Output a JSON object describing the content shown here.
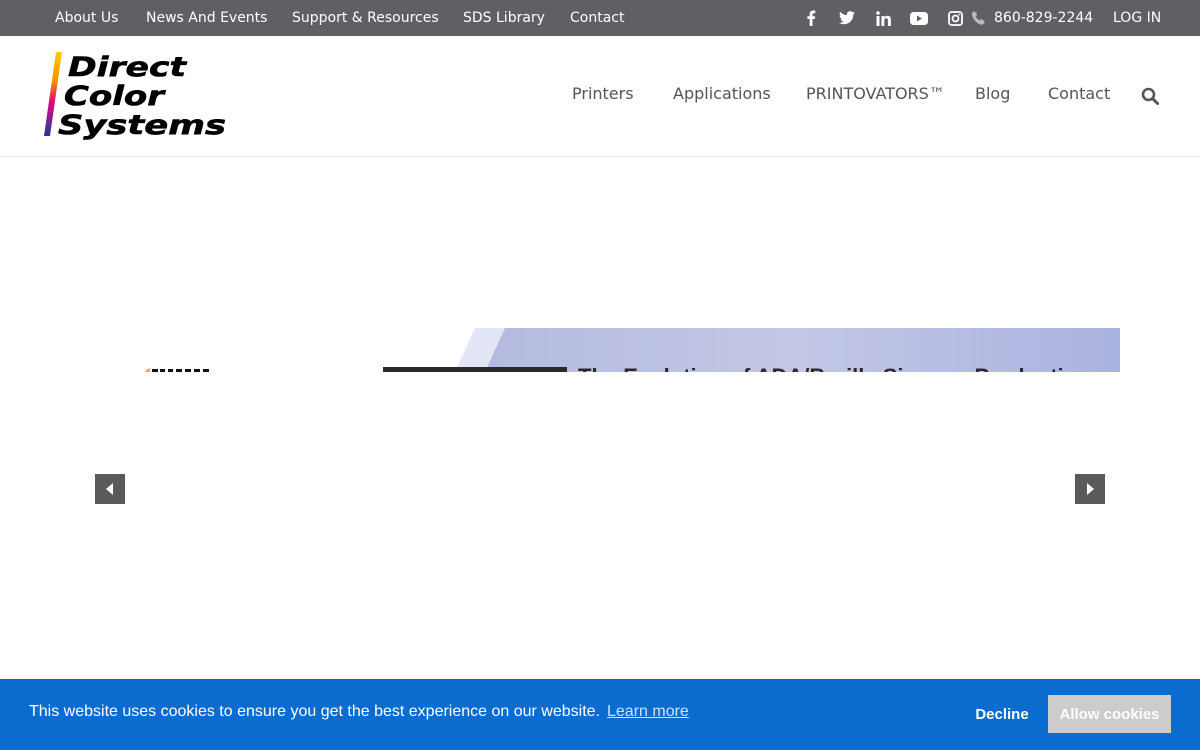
{
  "topbar": {
    "links": [
      "About Us",
      "News And Events",
      "Support & Resources",
      "SDS Library",
      "Contact"
    ],
    "social_icons": [
      "facebook-icon",
      "twitter-icon",
      "linkedin-icon",
      "youtube-icon",
      "instagram-icon"
    ],
    "phone": "860-829-2244",
    "login": "LOG IN"
  },
  "header": {
    "logo_lines": [
      "Direct",
      "Color",
      "Systems"
    ],
    "nav": [
      "Printers",
      "Applications",
      "PRINTOVATORS™",
      "Blog",
      "Contact"
    ]
  },
  "slider": {
    "title": "The Evolution of ADA/Braille Signage Production"
  },
  "cookie": {
    "message": "This website uses cookies to ensure you get the best experience on our website.",
    "learn_more": "Learn more",
    "decline": "Decline",
    "allow": "Allow cookies"
  },
  "colors": {
    "topbar": "#5f6063",
    "cookie_bar": "#0a6ccf",
    "banner_accent": "#aab2e0"
  }
}
